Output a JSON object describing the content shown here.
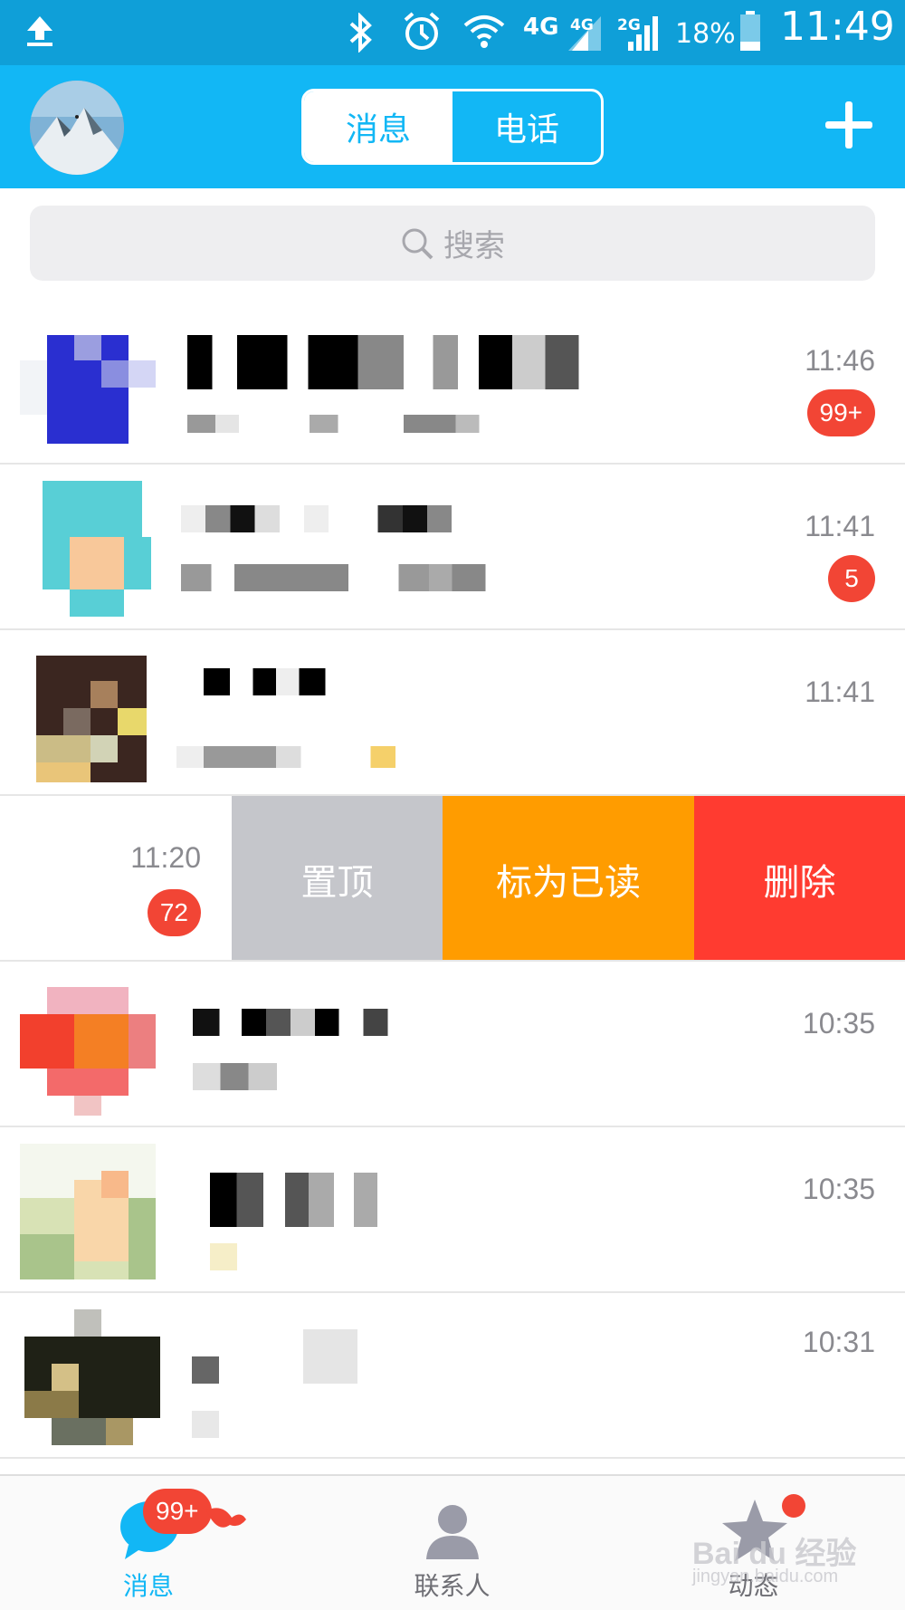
{
  "status_bar": {
    "network": "4G",
    "signal1": "4G",
    "signal2": "2G",
    "battery": "18%",
    "time": "11:49"
  },
  "header": {
    "tabs": [
      {
        "label": "消息",
        "active": true
      },
      {
        "label": "电话",
        "active": false
      }
    ],
    "add_icon": "plus-icon"
  },
  "search": {
    "placeholder": "搜索"
  },
  "conversations": [
    {
      "time": "11:46",
      "unread": "99+"
    },
    {
      "time": "11:41",
      "unread": "5"
    },
    {
      "time": "11:41",
      "unread": ""
    },
    {
      "time": "11:20",
      "unread": "72",
      "swiped": true
    },
    {
      "time": "10:35",
      "unread": ""
    },
    {
      "time": "10:35",
      "unread": ""
    },
    {
      "time": "10:31",
      "unread": ""
    }
  ],
  "swipe_actions": {
    "pin": "置顶",
    "mark_read": "标为已读",
    "delete": "删除"
  },
  "tabbar": {
    "messages": {
      "label": "消息",
      "badge": "99+"
    },
    "contacts": {
      "label": "联系人"
    },
    "feed": {
      "label": "动态"
    }
  },
  "watermark": {
    "brand": "Bai du 经验",
    "url": "jingyan.baidu.com"
  },
  "colors": {
    "brand_blue": "#12b7f5",
    "badge_red": "#f24535",
    "pin_gray": "#c5c6cb",
    "read_orange": "#ff9c00",
    "delete_red": "#ff3b30"
  }
}
